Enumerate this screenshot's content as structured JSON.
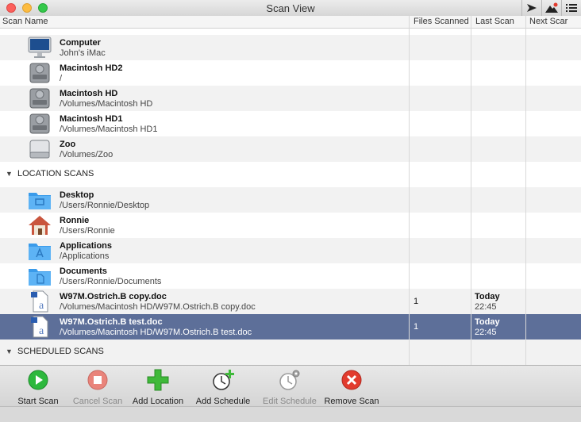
{
  "window": {
    "title": "Scan View"
  },
  "columns": {
    "scan_name": "Scan Name",
    "files_scanned": "Files Scanned",
    "last_scan": "Last Scan",
    "next_scan": "Next Scar"
  },
  "device_rows": [
    {
      "name": "Computer",
      "path": "John's iMac",
      "icon": "imac-icon"
    },
    {
      "name": "Macintosh HD2",
      "path": "/",
      "icon": "hard-drive-icon"
    },
    {
      "name": "Macintosh HD",
      "path": "/Volumes/Macintosh HD",
      "icon": "hard-drive-icon"
    },
    {
      "name": "Macintosh HD1",
      "path": "/Volumes/Macintosh HD1",
      "icon": "hard-drive-icon"
    },
    {
      "name": "Zoo",
      "path": "/Volumes/Zoo",
      "icon": "external-drive-icon"
    }
  ],
  "location_section": {
    "label": "LOCATION SCANS"
  },
  "location_rows": [
    {
      "name": "Desktop",
      "path": "/Users/Ronnie/Desktop",
      "icon": "desktop-folder-icon"
    },
    {
      "name": "Ronnie",
      "path": "/Users/Ronnie",
      "icon": "home-folder-icon"
    },
    {
      "name": "Applications",
      "path": "/Applications",
      "icon": "applications-folder-icon"
    },
    {
      "name": "Documents",
      "path": "/Users/Ronnie/Documents",
      "icon": "documents-folder-icon"
    },
    {
      "name": "W97M.Ostrich.B copy.doc",
      "path": "/Volumes/Macintosh HD/W97M.Ostrich.B copy.doc",
      "icon": "document-file-icon",
      "files": "1",
      "last_day": "Today",
      "last_time": "22:45"
    },
    {
      "name": "W97M.Ostrich.B test.doc",
      "path": "/Volumes/Macintosh HD/W97M.Ostrich.B test.doc",
      "icon": "document-file-icon",
      "files": "1",
      "last_day": "Today",
      "last_time": "22:45",
      "selected": true
    }
  ],
  "scheduled_section": {
    "label": "SCHEDULED SCANS"
  },
  "toolbar": {
    "start_scan": "Start Scan",
    "cancel_scan": "Cancel Scan",
    "add_location": "Add Location",
    "add_schedule": "Add Schedule",
    "edit_schedule": "Edit Schedule",
    "remove_scan": "Remove Scan"
  },
  "colors": {
    "selection": "#5d6f99",
    "start": "#2db83d",
    "cancel": "#e2594f",
    "add": "#3fb93a",
    "remove": "#e23b2e"
  }
}
